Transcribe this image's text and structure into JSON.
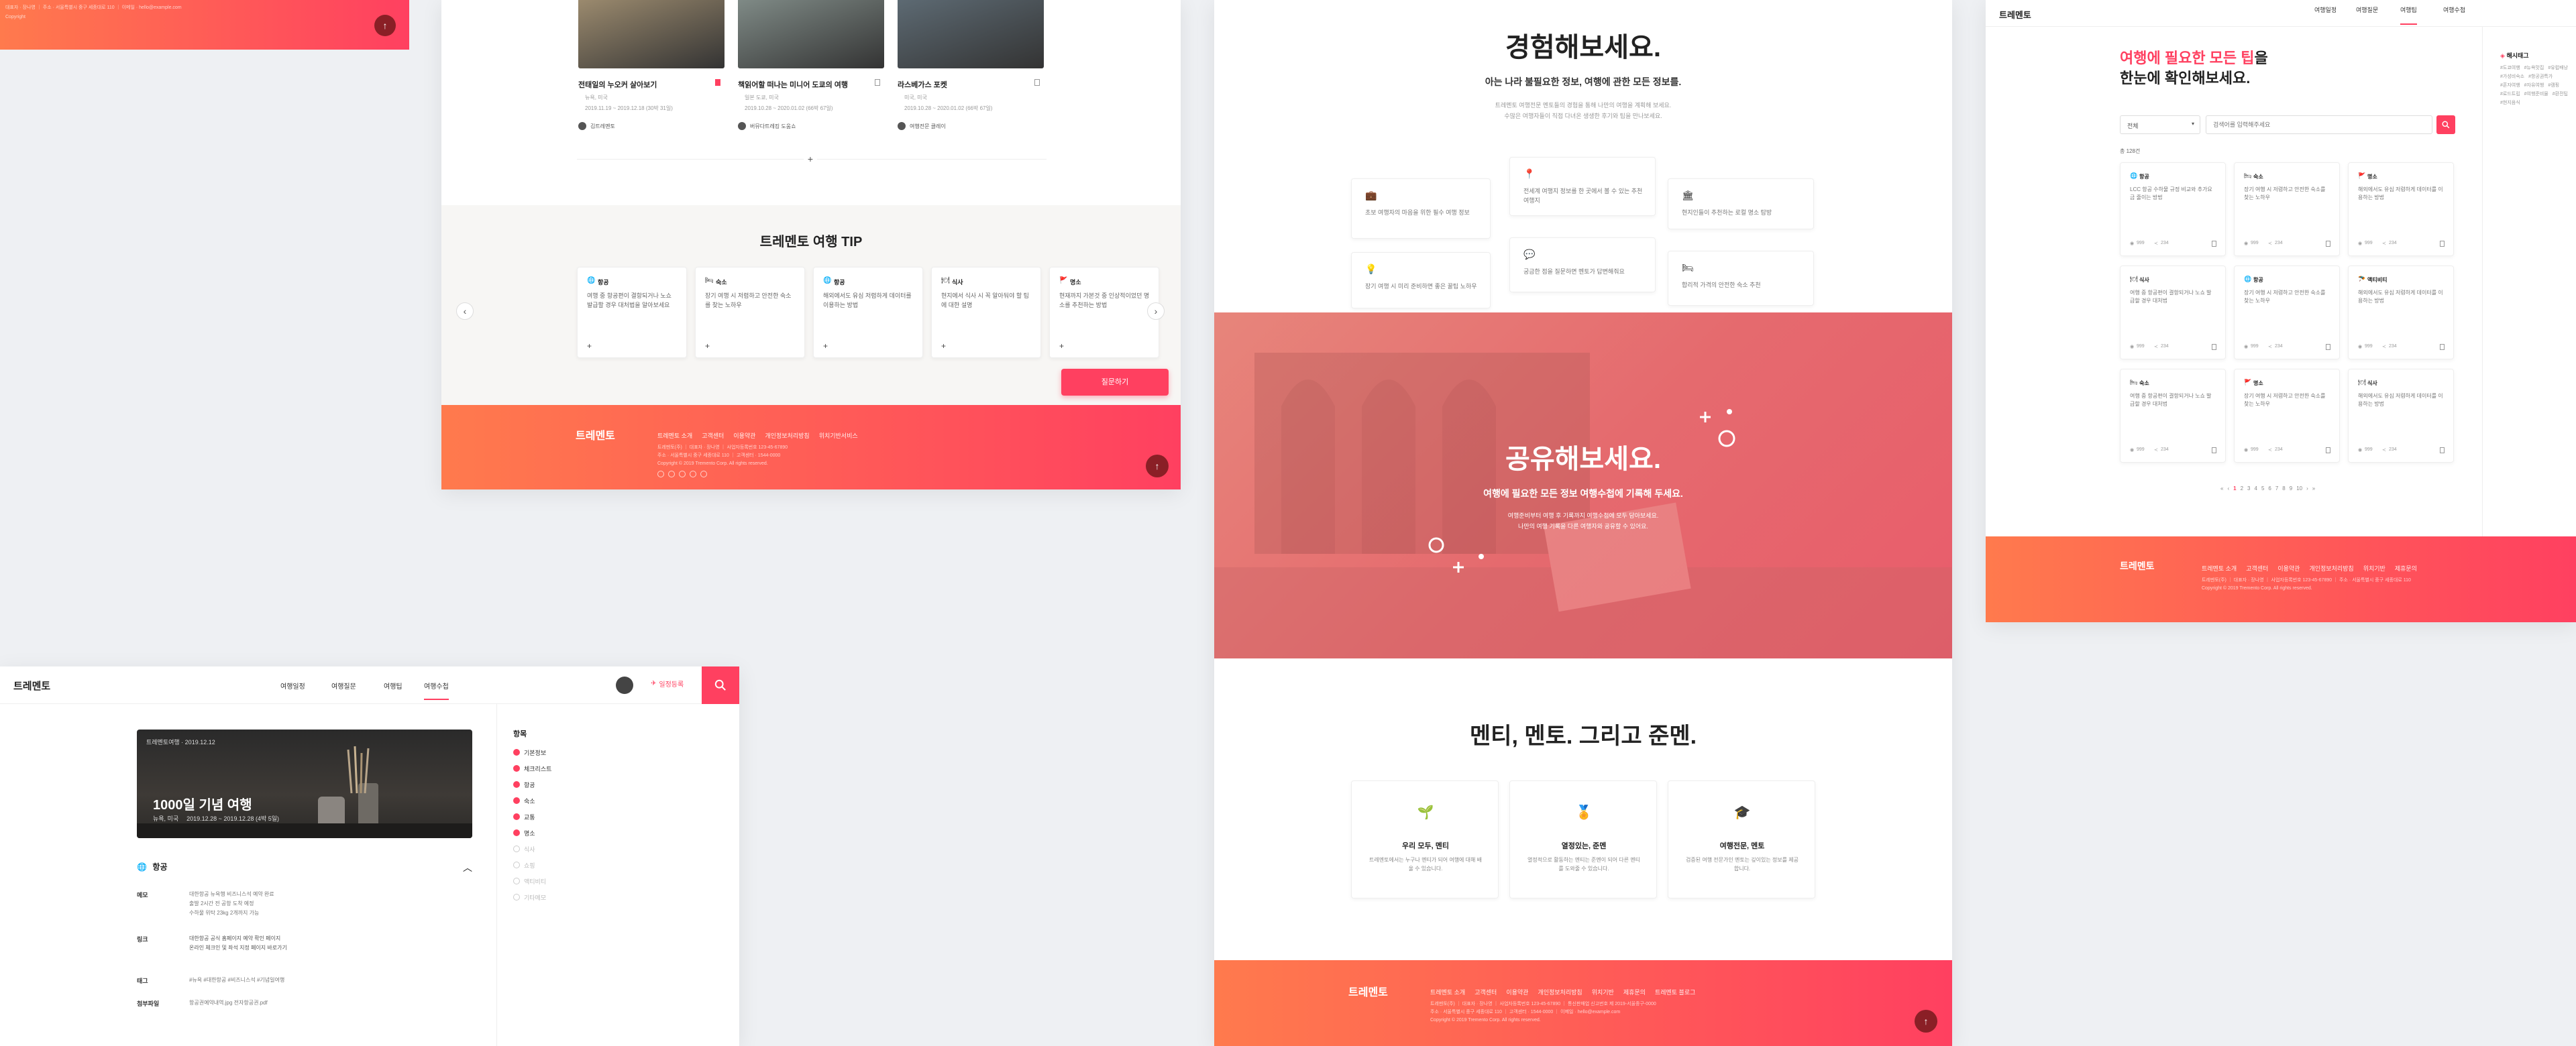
{
  "fragment_footer": {
    "line1": "대표자 · 장나영 ｜ 주소 · 서울특별시 중구 세종대로 110 ｜ 이메일 · hello@example.com",
    "line2": "Copyright"
  },
  "panel_a": {
    "photos": [
      {
        "title": "전태일의 누오커 살아보기",
        "meta1": "뉴욕, 미국",
        "meta2": "2019.11.19 ~ 2019.12.18 (30박 31일)",
        "author": "김트레멘토"
      },
      {
        "title": "책읽어할 떠나는 미니어 도쿄의 여행",
        "meta1": "일본 도쿄, 미국",
        "meta2": "2019.10.28 ~ 2020.01.02 (66박 67일)",
        "author": "버뮤다트레킹 도움쇼"
      },
      {
        "title": "라스베가스 포켓",
        "meta1": "미국, 미국",
        "meta2": "2019.10.28 ~ 2020.01.02 (66박 67일)",
        "author": "여행전문 클레이"
      }
    ],
    "more_label": "+",
    "tip_title": "트레멘토 여행 TIP",
    "tips": [
      {
        "cat": "항공",
        "text": "여행 중 항공편이 결항되거나 노쇼 발급할 경우 대처법을 알아보세요"
      },
      {
        "cat": "숙소",
        "text": "장기 여행 시 저렴하고 안전한 숙소를 찾는 노하우"
      },
      {
        "cat": "항공",
        "text": "해외에서도 유심 저렴하게 데이터를 이용하는 방법"
      },
      {
        "cat": "식사",
        "text": "현지에서 식사 시 꼭 알아둬야 할 팁에 대한 설명"
      },
      {
        "cat": "명소",
        "text": "현재까지 가본것 중 인상적이었던 명소를 추천하는 방법"
      }
    ],
    "prev_icon": "‹",
    "next_icon": "›",
    "cta": "질문하기",
    "logo": "트레멘토",
    "footer_links": [
      "트레멘토 소개",
      "고객센터",
      "이용약관",
      "개인정보처리방침",
      "위치기반서비스"
    ],
    "footer_info1": "트레멘토(주) ｜ 대표자 · 장나영 ｜ 사업자등록번호 123-45-67890",
    "footer_info2": "주소 · 서울특별시 중구 세종대로 110 ｜ 고객센터 · 1544-0000",
    "copyright": "Copyright © 2019 Tremento Corp. All rights reserved.",
    "top_icon": "↑"
  },
  "panel_b": {
    "logo": "트레멘토",
    "nav": [
      "여행일정",
      "여행질문",
      "여행팁",
      "여행수첩"
    ],
    "write_label": "일정등록",
    "hero_label": "트레멘토여행 · 2019.12.12",
    "hero_title": "1000일 기념 여행",
    "hero_meta1": "뉴욕, 미국",
    "hero_meta2": "2019.12.28 ~ 2019.12.28 (4박 5일)",
    "section": "항공",
    "collapse_icon": "︿",
    "rows": [
      {
        "label": "메모",
        "lines": [
          "대한항공 뉴욕행 비즈니스석 예약 완료",
          "출발 2시간 전 공항 도착 예정",
          "수하물 위탁 23kg 2개까지 가능"
        ]
      },
      {
        "label": "링크",
        "lines": [
          "대한항공 공식 홈페이지 예약 확인 페이지",
          "온라인 체크인 및 좌석 지정 페이지 바로가기"
        ]
      },
      {
        "label": "태그",
        "lines": [
          "#뉴욕 #대한항공 #비즈니스석 #기념일여행"
        ]
      },
      {
        "label": "첨부파일",
        "lines": [
          "항공권예약내역.jpg  전자항공권.pdf"
        ]
      }
    ],
    "toc_title": "항목",
    "toc": [
      "기본정보",
      "체크리스트",
      "항공",
      "숙소",
      "교통",
      "명소",
      "식사",
      "쇼핑",
      "액티비티",
      "기타메모"
    ],
    "toc_active_count": 6
  },
  "panel_c": {
    "h1": "경험해보세요.",
    "sub1": "아는 나라 불필요한 정보, 여행에 관한 모든 정보를.",
    "desc1": "트레멘토 여행전문 멘토들의 경험을 통해 나만의 여행을 계획해 보세요.",
    "desc1b": "수많은 여행자들이 직접 다녀온 생생한 후기와 팁을 만나보세요.",
    "features": [
      {
        "icon": "suitcase",
        "text": "초보 여행자의 마음을 위한 필수 여행 정보"
      },
      {
        "icon": "pin",
        "text": "전세계 여행지 정보를 한 곳에서 볼 수 있는 추천 여행지"
      },
      {
        "icon": "building",
        "text": "현지인들이 추천하는 로컬 명소 탐방"
      },
      {
        "icon": "bulb",
        "text": "장기 여행 시 미리 준비하면 좋은 꿀팁 노하우"
      },
      {
        "icon": "chat",
        "text": "궁금한 점을 질문하면 멘토가 답변해줘요"
      },
      {
        "icon": "bed",
        "text": "합리적 가격의 안전한 숙소 추천"
      }
    ],
    "h2": "공유해보세요.",
    "sub2": "여행에 필요한 모든 정보 여행수첩에 기록해 두세요.",
    "desc2a": "여행준비부터 여행 후 기록까지 여행수첩에 모두 담아보세요.",
    "desc2b": "나만의 여행 기록을 다른 여행자와 공유할 수 있어요.",
    "h3": "멘티, 멘토. 그리고 준멘.",
    "roles": [
      {
        "icon": "sprout",
        "title": "우리 모두, 멘티",
        "text": "트레멘토에서는 누구나 멘티가 되어 여행에 대해 배울 수 있습니다."
      },
      {
        "icon": "medal",
        "title": "열정있는, 준멘",
        "text": "열정적으로 활동하는 멘티는 준멘이 되어 다른 멘티를 도와줄 수 있습니다."
      },
      {
        "icon": "cap",
        "title": "여행전문, 멘토",
        "text": "검증된 여행 전문가인 멘토는 깊이있는 정보를 제공합니다."
      }
    ],
    "logo": "트레멘토",
    "footer_links": [
      "트레멘토 소개",
      "고객센터",
      "이용약관",
      "개인정보처리방침",
      "위치기반",
      "제휴문의",
      "트레멘토 블로그"
    ],
    "footer_info1": "트레멘토(주) ｜ 대표자 · 장나영 ｜ 사업자등록번호 123-45-67890 ｜ 통신판매업 신고번호 제 2019-서울중구-0000",
    "footer_info2": "주소 · 서울특별시 중구 세종대로 110 ｜ 고객센터 · 1544-0000 ｜ 이메일 · hello@example.com",
    "copyright": "Copyright © 2019 Tremento Corp. All rights reserved.",
    "top_icon": "↑"
  },
  "panel_d": {
    "logo": "트레멘토",
    "nav": [
      "여행일정",
      "여행질문",
      "여행팁",
      "여행수첩"
    ],
    "title_red": "여행에 필요한 모든 팁",
    "title_rest": "을",
    "title2": "한눈에 확인해보세요.",
    "select": "전체",
    "search_placeholder": "검색어를 입력해주세요",
    "count": "총 128건",
    "cards": [
      {
        "cat": "항공",
        "text": "LCC 항공 수하물 규정 비교와 추가요금 줄이는 방법",
        "v": "999",
        "c": "234"
      },
      {
        "cat": "숙소",
        "text": "장기 여행 시 저렴하고 안전한 숙소를 찾는 노하우",
        "v": "999",
        "c": "234"
      },
      {
        "cat": "명소",
        "text": "해외에서도 유심 저렴하게 데이터를 이용하는 방법",
        "v": "999",
        "c": "234"
      },
      {
        "cat": "식사",
        "text": "여행 중 항공편이 결항되거나 노쇼 발급할 경우 대처법",
        "v": "999",
        "c": "234"
      },
      {
        "cat": "항공",
        "text": "장기 여행 시 저렴하고 안전한 숙소를 찾는 노하우",
        "v": "999",
        "c": "234"
      },
      {
        "cat": "액티비티",
        "text": "해외에서도 유심 저렴하게 데이터를 이용하는 방법",
        "v": "999",
        "c": "234"
      },
      {
        "cat": "숙소",
        "text": "여행 중 항공편이 결항되거나 노쇼 발급할 경우 대처법",
        "v": "999",
        "c": "234"
      },
      {
        "cat": "명소",
        "text": "장기 여행 시 저렴하고 안전한 숙소를 찾는 노하우",
        "v": "999",
        "c": "234"
      },
      {
        "cat": "식사",
        "text": "해외에서도 유심 저렴하게 데이터를 이용하는 방법",
        "v": "999",
        "c": "234"
      }
    ],
    "pages": [
      "«",
      "‹",
      "1",
      "2",
      "3",
      "4",
      "5",
      "6",
      "7",
      "8",
      "9",
      "10",
      "›",
      "»"
    ],
    "side_title": "해시태그",
    "side_tags": [
      "#도쿄여행",
      "#뉴욕맛집",
      "#유럽배낭",
      "#가성비숙소",
      "#항공권특가",
      "#혼자여행",
      "#자유여행",
      "#캠핑",
      "#로드트립",
      "#여행준비물",
      "#환전팁",
      "#현지음식"
    ],
    "logo_footer": "트레멘토",
    "footer_links": [
      "트레멘토 소개",
      "고객센터",
      "이용약관",
      "개인정보처리방침",
      "위치기반",
      "제휴문의"
    ],
    "footer_info1": "트레멘토(주) ｜ 대표자 · 장나영 ｜ 사업자등록번호 123-45-67890 ｜ 주소 · 서울특별시 중구 세종대로 110",
    "footer_info2": "Copyright © 2019 Tremento Corp. All rights reserved."
  },
  "colors": {
    "accent": "#ff4060",
    "orange": "#ff7a4d",
    "dark": "#222222"
  }
}
